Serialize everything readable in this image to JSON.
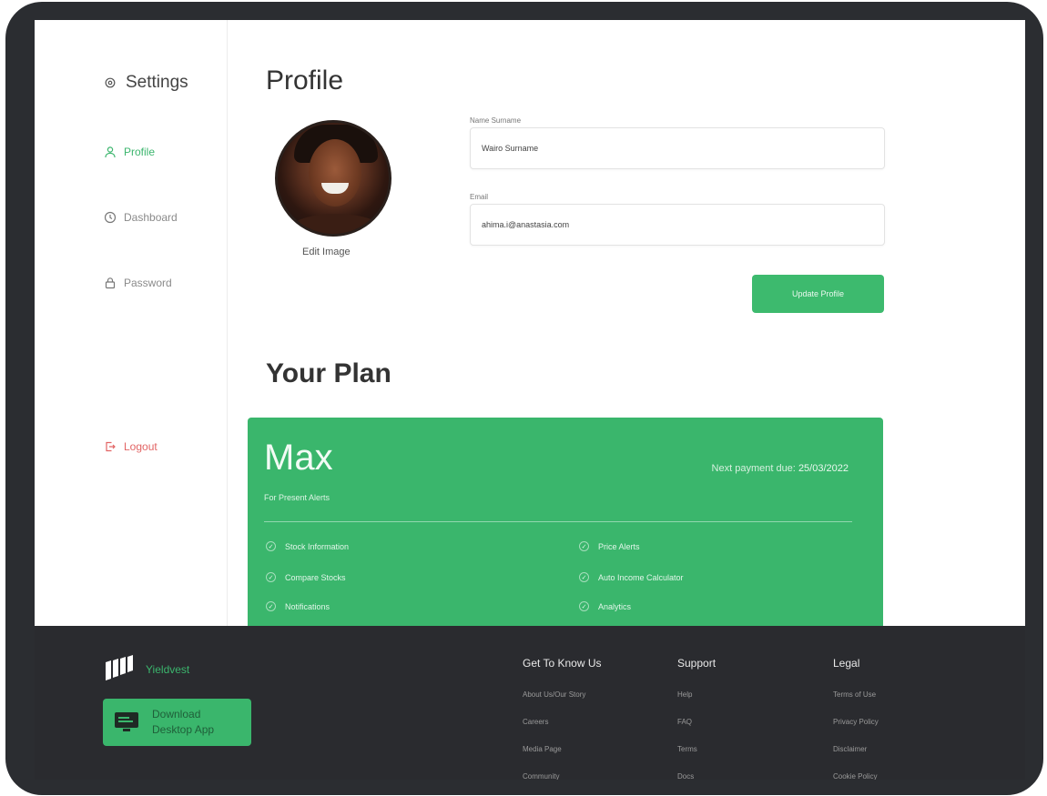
{
  "sidebar": {
    "settings_label": "Settings",
    "items": [
      {
        "label": "Profile"
      },
      {
        "label": "Dashboard"
      },
      {
        "label": "Password"
      },
      {
        "label": "Logout"
      }
    ]
  },
  "profile": {
    "title": "Profile",
    "edit_image_label": "Edit Image",
    "name_label": "Name Surname",
    "name_value": "Wairo Surname",
    "email_label": "Email",
    "email_value": "ahima.i@anastasia.com",
    "update_button": "Update Profile"
  },
  "plan": {
    "title": "Your Plan",
    "name": "Max",
    "subtitle": "For Present Alerts",
    "next_payment_label": "Next payment due:",
    "next_payment_date": "25/03/2022",
    "features": [
      "Stock Information",
      "Compare Stocks",
      "Notifications",
      "Price Alerts",
      "Auto Income Calculator",
      "Analytics"
    ]
  },
  "footer": {
    "brand": "Yieldvest",
    "download_line1": "Download",
    "download_line2": "Desktop App",
    "columns": [
      {
        "heading": "Get To Know Us",
        "links": [
          "About Us/Our Story",
          "Careers",
          "Media Page",
          "Community"
        ]
      },
      {
        "heading": "Support",
        "links": [
          "Help",
          "FAQ",
          "Terms",
          "Docs"
        ]
      },
      {
        "heading": "Legal",
        "links": [
          "Terms of Use",
          "Privacy Policy",
          "Disclaimer",
          "Cookie Policy"
        ]
      }
    ]
  },
  "colors": {
    "accent": "#3ab66c",
    "logout": "#e26464",
    "footer_bg": "#2a2b2f",
    "device_frame": "#2b2d31"
  }
}
